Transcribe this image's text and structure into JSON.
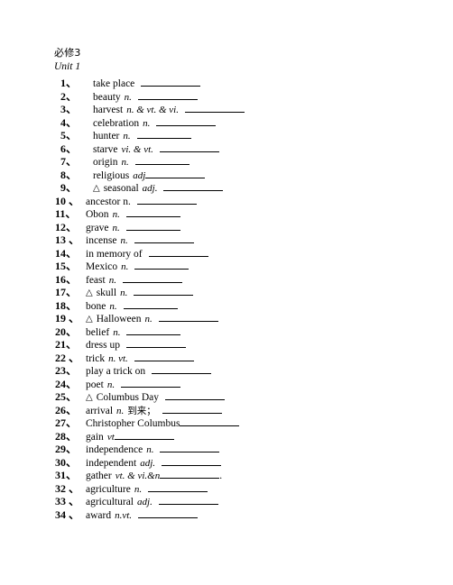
{
  "document": {
    "book_title": "必修3",
    "unit_title": "Unit 1",
    "separator": "、",
    "triangle_marker": "△"
  },
  "vocab": {
    "items": [
      {
        "num": "1",
        "sep": "、",
        "word": "take place",
        "pos": "",
        "marker": "",
        "gloss": "",
        "tail": "",
        "blank_width": 66,
        "gap": true
      },
      {
        "num": "2",
        "sep": "、",
        "word": "beauty",
        "pos": "n.",
        "marker": "",
        "gloss": "",
        "tail": "",
        "blank_width": 66,
        "gap": true
      },
      {
        "num": "3",
        "sep": "、",
        "word": "harvest",
        "pos": "n. & vt. & vi.",
        "marker": "",
        "gloss": "",
        "tail": "",
        "blank_width": 66,
        "gap": true
      },
      {
        "num": "4",
        "sep": "、",
        "word": "celebration",
        "pos": "n.",
        "marker": "",
        "gloss": "",
        "tail": "",
        "blank_width": 66,
        "gap": true
      },
      {
        "num": "5",
        "sep": "、",
        "word": "hunter",
        "pos": "n.",
        "marker": "",
        "gloss": "",
        "tail": "",
        "blank_width": 60,
        "gap": true
      },
      {
        "num": "6",
        "sep": "、",
        "word": "starve",
        "pos": "vi. & vt.",
        "marker": "",
        "gloss": "",
        "tail": "",
        "blank_width": 66,
        "gap": true
      },
      {
        "num": "7",
        "sep": "、",
        "word": "origin",
        "pos": "n.",
        "marker": "",
        "gloss": "",
        "tail": "",
        "blank_width": 60,
        "gap": true
      },
      {
        "num": "8",
        "sep": "、",
        "word": "religious",
        "pos": "adj",
        "marker": "",
        "gloss": "",
        "tail": "",
        "blank_width": 66,
        "gap": false
      },
      {
        "num": "9",
        "sep": "、",
        "word": "seasonal",
        "pos": "adj.",
        "marker": "△",
        "gloss": "",
        "tail": "",
        "blank_width": 66,
        "gap": true
      },
      {
        "num": "10",
        "sep": " 、",
        "word": "ancestor n.",
        "pos": "",
        "marker": "",
        "gloss": "",
        "tail": "",
        "blank_width": 66,
        "gap": true
      },
      {
        "num": "11",
        "sep": "、",
        "word": "Obon",
        "pos": "n.",
        "marker": "",
        "gloss": "",
        "tail": "",
        "blank_width": 60,
        "gap": true
      },
      {
        "num": "12",
        "sep": "、",
        "word": "grave",
        "pos": "n.",
        "marker": "",
        "gloss": "",
        "tail": "",
        "blank_width": 60,
        "gap": true
      },
      {
        "num": "13",
        "sep": " 、",
        "word": "incense",
        "pos": "n.",
        "marker": "",
        "gloss": "",
        "tail": "",
        "blank_width": 66,
        "gap": true
      },
      {
        "num": "14",
        "sep": "、",
        "word": "in memory of",
        "pos": "",
        "marker": "",
        "gloss": "",
        "tail": "",
        "blank_width": 66,
        "gap": true
      },
      {
        "num": "15",
        "sep": "、",
        "word": "Mexico",
        "pos": "n.",
        "marker": "",
        "gloss": "",
        "tail": "",
        "blank_width": 60,
        "gap": true
      },
      {
        "num": "16",
        "sep": "、",
        "word": "feast",
        "pos": "n.",
        "marker": "",
        "gloss": "",
        "tail": "",
        "blank_width": 66,
        "gap": true
      },
      {
        "num": "17",
        "sep": "、",
        "word": "skull",
        "pos": "n.",
        "marker": "△",
        "gloss": "",
        "tail": "",
        "blank_width": 66,
        "gap": true
      },
      {
        "num": "18",
        "sep": "、",
        "word": "bone",
        "pos": "n.",
        "marker": "",
        "gloss": "",
        "tail": "",
        "blank_width": 60,
        "gap": true
      },
      {
        "num": "19",
        "sep": " 、",
        "word": "Halloween",
        "pos": "n.",
        "marker": "△",
        "gloss": "",
        "tail": "",
        "blank_width": 66,
        "gap": true
      },
      {
        "num": "20",
        "sep": "、",
        "word": "belief",
        "pos": "n.",
        "marker": "",
        "gloss": "",
        "tail": "",
        "blank_width": 60,
        "gap": true
      },
      {
        "num": "21",
        "sep": "、",
        "word": "dress up",
        "pos": "",
        "marker": "",
        "gloss": "",
        "tail": "",
        "blank_width": 66,
        "gap": true
      },
      {
        "num": "22",
        "sep": " 、",
        "word": "trick",
        "pos": "n. vt.",
        "marker": "",
        "gloss": "",
        "tail": "",
        "blank_width": 66,
        "gap": true
      },
      {
        "num": "23",
        "sep": "、",
        "word": "play a trick on",
        "pos": "",
        "marker": "",
        "gloss": "",
        "tail": "",
        "blank_width": 66,
        "gap": true
      },
      {
        "num": "24",
        "sep": "、",
        "word": "poet",
        "pos": "n.",
        "marker": "",
        "gloss": "",
        "tail": "",
        "blank_width": 66,
        "gap": true
      },
      {
        "num": "25",
        "sep": "、",
        "word": "Columbus Day",
        "pos": "",
        "marker": "△",
        "gloss": "",
        "tail": "",
        "blank_width": 66,
        "gap": true
      },
      {
        "num": "26",
        "sep": "、",
        "word": "arrival",
        "pos": "n.",
        "marker": "",
        "gloss": "到来；",
        "tail": "",
        "blank_width": 66,
        "gap": true
      },
      {
        "num": "27",
        "sep": "、",
        "word": "Christopher Columbus",
        "pos": "",
        "marker": "",
        "gloss": "",
        "tail": "",
        "blank_width": 66,
        "gap": false
      },
      {
        "num": "28",
        "sep": "、",
        "word": "gain",
        "pos": "vt",
        "marker": "",
        "gloss": "",
        "tail": "",
        "blank_width": 66,
        "gap": false
      },
      {
        "num": "29",
        "sep": "、",
        "word": "independence",
        "pos": "n.",
        "marker": "",
        "gloss": "",
        "tail": "",
        "blank_width": 66,
        "gap": true
      },
      {
        "num": "30",
        "sep": "、",
        "word": "independent",
        "pos": "adj.",
        "marker": "",
        "gloss": "",
        "tail": "",
        "blank_width": 66,
        "gap": true
      },
      {
        "num": "31",
        "sep": "、",
        "word": "gather",
        "pos": "vt. & vi.&n",
        "marker": "",
        "gloss": "",
        "tail": ".",
        "blank_width": 66,
        "gap": false
      },
      {
        "num": "32",
        "sep": " 、",
        "word": "agriculture",
        "pos": "n.",
        "marker": "",
        "gloss": "",
        "tail": "",
        "blank_width": 66,
        "gap": true
      },
      {
        "num": "33",
        "sep": " 、",
        "word": "agricultural",
        "pos": "adj.",
        "marker": "",
        "gloss": "",
        "tail": "",
        "blank_width": 66,
        "gap": true
      },
      {
        "num": "34",
        "sep": " 、",
        "word": "award",
        "pos": "n.vt.",
        "marker": "",
        "gloss": "",
        "tail": "",
        "blank_width": 66,
        "gap": true
      }
    ]
  }
}
